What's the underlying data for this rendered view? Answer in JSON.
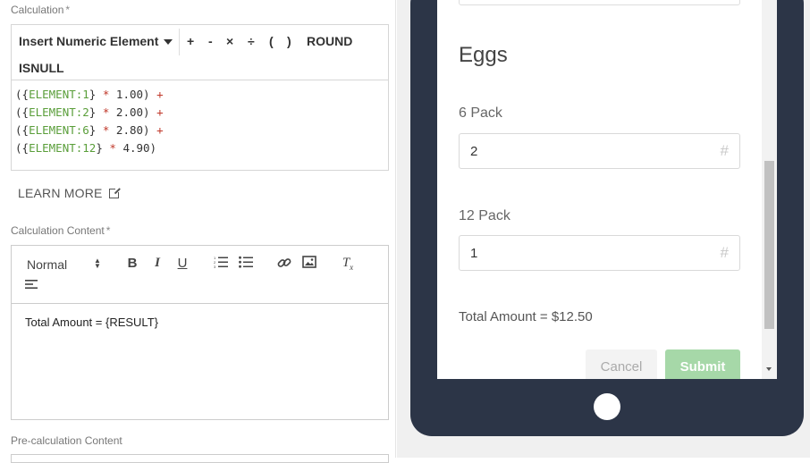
{
  "calculation": {
    "label": "Calculation",
    "required_mark": "*",
    "insert_label": "Insert Numeric Element",
    "operators": [
      "+",
      "-",
      "×",
      "÷",
      "(",
      ")",
      "ROUND"
    ],
    "isnull_label": "ISNULL",
    "lines": [
      {
        "open": "({",
        "el": "ELEMENT:1",
        "close": "}",
        "star": "*",
        "num": "1.00)",
        "plus": "+"
      },
      {
        "open": "({",
        "el": "ELEMENT:2",
        "close": "}",
        "star": "*",
        "num": "2.00)",
        "plus": "+"
      },
      {
        "open": "({",
        "el": "ELEMENT:6",
        "close": "}",
        "star": "*",
        "num": "2.80)",
        "plus": "+"
      },
      {
        "open": "({",
        "el": "ELEMENT:12",
        "close": "}",
        "star": "*",
        "num": "4.90)",
        "plus": ""
      }
    ]
  },
  "learn_more": "LEARN MORE",
  "calc_content": {
    "label": "Calculation Content",
    "required_mark": "*",
    "format_select": "Normal",
    "text": "Total Amount = {RESULT}"
  },
  "precalc": {
    "label": "Pre-calculation Content"
  },
  "preview": {
    "section_title": "Eggs",
    "fields": [
      {
        "label": "6 Pack",
        "value": "2",
        "hash": "#"
      },
      {
        "label": "12 Pack",
        "value": "1",
        "hash": "#"
      }
    ],
    "total_text": "Total Amount = $12.50",
    "cancel_label": "Cancel",
    "submit_label": "Submit"
  },
  "colors": {
    "tablet": "#2c3547",
    "submit": "#a6d8a8",
    "element_token": "#5a9e3a",
    "operator_token": "#c0392b"
  }
}
